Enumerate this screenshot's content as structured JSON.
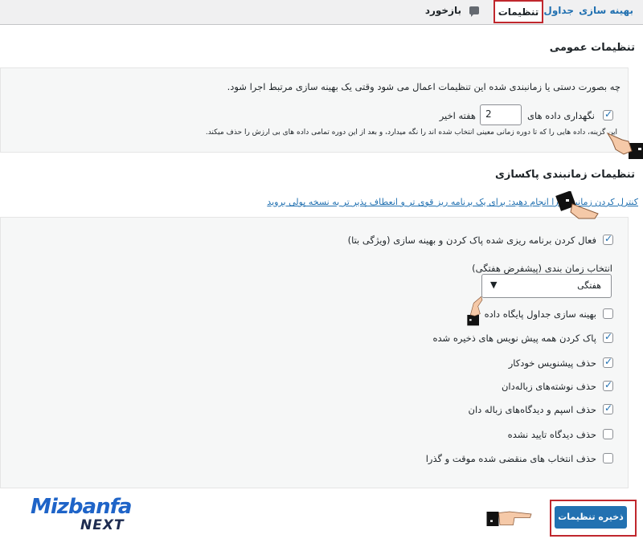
{
  "tabs": [
    {
      "label": "بهینه سازی"
    },
    {
      "label": "جداول"
    },
    {
      "label": "تنظیمات"
    },
    {
      "label": "بازخورد"
    }
  ],
  "general": {
    "title": "تنظیمات عمومی",
    "description": "چه بصورت دستی یا زمانبندی شده این تنظیمات اعمال می شود وقتی یک بهینه سازی مرتبط اجرا شود.",
    "keep_label": "نگهداری داده های",
    "keep_value": "2",
    "keep_unit": "هفته اخیر",
    "keep_help": "این گزینه، داده هایی را که تا دوره زمانی معینی انتخاب شده اند را نگه میدارد، و بعد از این دوره تمامی داده های بی ارزش را حذف میکند."
  },
  "schedule": {
    "title": "تنظیمات زمانبندی پاکسازی",
    "link_text": "کنترل کردن زمانبندی را انجام دهید: برای یک برنامه ریز قوی تر و انعطاف پذیر تر به نسخه پولی بروید",
    "enable_label": "فعال کردن برنامه ریزی شده پاک کردن و بهینه سازی (ویژگی بتا)",
    "interval_label": "انتخاب زمان بندی (پیشفرض هفتگی)",
    "interval_value": "هفتگی",
    "options": [
      {
        "label": "بهینه سازی جداول پایگاه داده",
        "checked": false
      },
      {
        "label": "پاک کردن همه پیش نویس های ذخیره شده",
        "checked": true
      },
      {
        "label": "حذف پیشنویس خودکار",
        "checked": true
      },
      {
        "label": "حذف نوشته‌های زباله‌دان",
        "checked": true
      },
      {
        "label": "حذف اسپم و دیدگاه‌های زباله دان",
        "checked": true
      },
      {
        "label": "حذف دیدگاه تایید نشده",
        "checked": false
      },
      {
        "label": "حذف انتخاب های منقضی شده موقت و گذرا",
        "checked": false
      }
    ]
  },
  "save_label": "ذخیره تنظیمات",
  "logo": {
    "line1": "Mizbanfa",
    "line2": "NEXT"
  },
  "colors": {
    "accent": "#2271b1",
    "highlight": "#c0272d"
  }
}
